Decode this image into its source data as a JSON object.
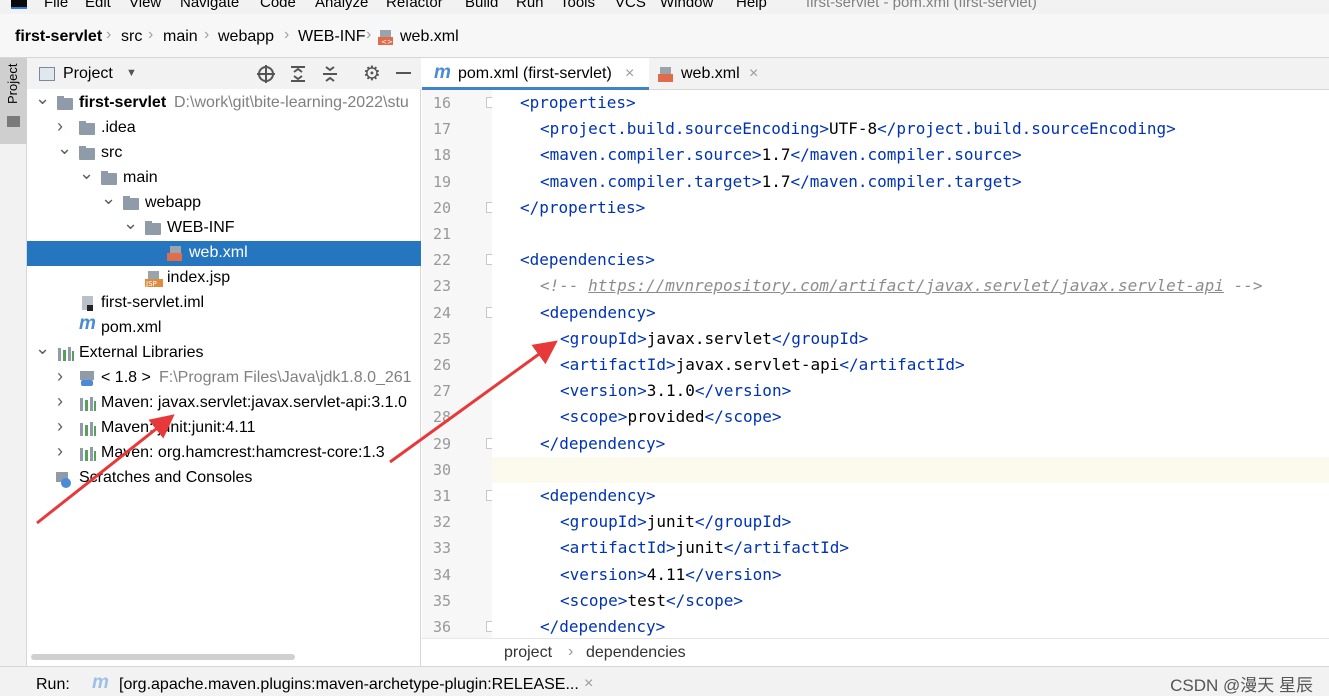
{
  "menubar": {
    "items": [
      "File",
      "Edit",
      "View",
      "Navigate",
      "Code",
      "Analyze",
      "Refactor",
      "Build",
      "Run",
      "Tools",
      "VCS",
      "Window",
      "Help"
    ],
    "window_title": "first-servlet - pom.xml (first-servlet)"
  },
  "navbar": {
    "crumbs": [
      "first-servlet",
      "src",
      "main",
      "webapp",
      "WEB-INF",
      "web.xml"
    ]
  },
  "left_stripe": {
    "label": "Project"
  },
  "project_panel": {
    "title": "Project",
    "icons": [
      "locate-icon",
      "expand-all-icon",
      "collapse-all-icon",
      "gear-icon",
      "minimize-icon"
    ]
  },
  "tree": [
    {
      "label": "first-servlet",
      "path": "D:\\work\\git\\bite-learning-2022\\stu",
      "bold": true,
      "depth": 0,
      "arrow": "down",
      "icon": "module"
    },
    {
      "label": ".idea",
      "depth": 1,
      "arrow": "right",
      "icon": "folder"
    },
    {
      "label": "src",
      "depth": 1,
      "arrow": "down",
      "icon": "folder"
    },
    {
      "label": "main",
      "depth": 2,
      "arrow": "down",
      "icon": "folder"
    },
    {
      "label": "webapp",
      "depth": 3,
      "arrow": "down",
      "icon": "folder"
    },
    {
      "label": "WEB-INF",
      "depth": 4,
      "arrow": "down",
      "icon": "folder"
    },
    {
      "label": "web.xml",
      "depth": 5,
      "arrow": "",
      "icon": "xml",
      "selected": true
    },
    {
      "label": "index.jsp",
      "depth": 4,
      "arrow": "",
      "icon": "jsp"
    },
    {
      "label": "first-servlet.iml",
      "depth": 1,
      "arrow": "",
      "icon": "iml"
    },
    {
      "label": "pom.xml",
      "depth": 1,
      "arrow": "",
      "icon": "maven"
    },
    {
      "label": "External Libraries",
      "depth": 0,
      "arrow": "down",
      "icon": "lib"
    },
    {
      "label": "< 1.8 >",
      "path": "F:\\Program Files\\Java\\jdk1.8.0_261",
      "depth": 1,
      "arrow": "right",
      "icon": "jdk"
    },
    {
      "label": "Maven: javax.servlet:javax.servlet-api:3.1.0",
      "depth": 1,
      "arrow": "right",
      "icon": "lib"
    },
    {
      "label": "Maven: junit:junit:4.11",
      "depth": 1,
      "arrow": "right",
      "icon": "lib"
    },
    {
      "label": "Maven: org.hamcrest:hamcrest-core:1.3",
      "depth": 1,
      "arrow": "right",
      "icon": "lib"
    },
    {
      "label": "Scratches and Consoles",
      "depth": 0,
      "arrow": "",
      "icon": "scratch"
    }
  ],
  "tabs": [
    {
      "label": "pom.xml (first-servlet)",
      "active": true
    },
    {
      "label": "web.xml",
      "active": false
    }
  ],
  "code_lines": [
    {
      "n": 16,
      "indent": 1,
      "parts": [
        [
          "t",
          "<properties>"
        ]
      ]
    },
    {
      "n": 17,
      "indent": 2,
      "parts": [
        [
          "t",
          "<project.build.sourceEncoding>"
        ],
        [
          "x",
          "UTF-8"
        ],
        [
          "t",
          "</project.build.sourceEncoding>"
        ]
      ]
    },
    {
      "n": 18,
      "indent": 2,
      "parts": [
        [
          "t",
          "<maven.compiler.source>"
        ],
        [
          "x",
          "1.7"
        ],
        [
          "t",
          "</maven.compiler.source>"
        ]
      ]
    },
    {
      "n": 19,
      "indent": 2,
      "parts": [
        [
          "t",
          "<maven.compiler.target>"
        ],
        [
          "x",
          "1.7"
        ],
        [
          "t",
          "</maven.compiler.target>"
        ]
      ]
    },
    {
      "n": 20,
      "indent": 1,
      "parts": [
        [
          "t",
          "</properties>"
        ]
      ]
    },
    {
      "n": 21,
      "indent": 0,
      "parts": []
    },
    {
      "n": 22,
      "indent": 1,
      "parts": [
        [
          "t",
          "<dependencies>"
        ]
      ]
    },
    {
      "n": 23,
      "indent": 2,
      "parts": [
        [
          "c",
          "<!-- "
        ],
        [
          "cu",
          "https://mvnrepository.com/artifact/javax.servlet/javax.servlet-api"
        ],
        [
          "c",
          " -->"
        ]
      ]
    },
    {
      "n": 24,
      "indent": 2,
      "parts": [
        [
          "t",
          "<dependency>"
        ]
      ]
    },
    {
      "n": 25,
      "indent": 3,
      "parts": [
        [
          "t",
          "<groupId>"
        ],
        [
          "x",
          "javax.servlet"
        ],
        [
          "t",
          "</groupId>"
        ]
      ]
    },
    {
      "n": 26,
      "indent": 3,
      "parts": [
        [
          "t",
          "<artifactId>"
        ],
        [
          "x",
          "javax.servlet-api"
        ],
        [
          "t",
          "</artifactId>"
        ]
      ]
    },
    {
      "n": 27,
      "indent": 3,
      "parts": [
        [
          "t",
          "<version>"
        ],
        [
          "x",
          "3.1.0"
        ],
        [
          "t",
          "</version>"
        ]
      ]
    },
    {
      "n": 28,
      "indent": 3,
      "parts": [
        [
          "t",
          "<scope>"
        ],
        [
          "x",
          "provided"
        ],
        [
          "t",
          "</scope>"
        ]
      ]
    },
    {
      "n": 29,
      "indent": 2,
      "parts": [
        [
          "t",
          "</dependency>"
        ]
      ]
    },
    {
      "n": 30,
      "indent": 0,
      "parts": [],
      "current": true
    },
    {
      "n": 31,
      "indent": 2,
      "parts": [
        [
          "t",
          "<dependency>"
        ]
      ]
    },
    {
      "n": 32,
      "indent": 3,
      "parts": [
        [
          "t",
          "<groupId>"
        ],
        [
          "x",
          "junit"
        ],
        [
          "t",
          "</groupId>"
        ]
      ]
    },
    {
      "n": 33,
      "indent": 3,
      "parts": [
        [
          "t",
          "<artifactId>"
        ],
        [
          "x",
          "junit"
        ],
        [
          "t",
          "</artifactId>"
        ]
      ]
    },
    {
      "n": 34,
      "indent": 3,
      "parts": [
        [
          "t",
          "<version>"
        ],
        [
          "x",
          "4.11"
        ],
        [
          "t",
          "</version>"
        ]
      ]
    },
    {
      "n": 35,
      "indent": 3,
      "parts": [
        [
          "t",
          "<scope>"
        ],
        [
          "x",
          "test"
        ],
        [
          "t",
          "</scope>"
        ]
      ]
    },
    {
      "n": 36,
      "indent": 2,
      "parts": [
        [
          "t",
          "</dependency>"
        ]
      ]
    }
  ],
  "code_breadcrumb": [
    "project",
    "dependencies"
  ],
  "run": {
    "label": "Run:",
    "tab": "[org.apache.maven.plugins:maven-archetype-plugin:RELEASE...",
    "close": "×"
  },
  "watermark": "CSDN @漫天 星辰",
  "colors": {
    "tag": "#0033b3",
    "comment": "#8c8c8c",
    "selection": "#2675bf",
    "arrow": "#e8393a",
    "current_line": "#fcfaed"
  }
}
